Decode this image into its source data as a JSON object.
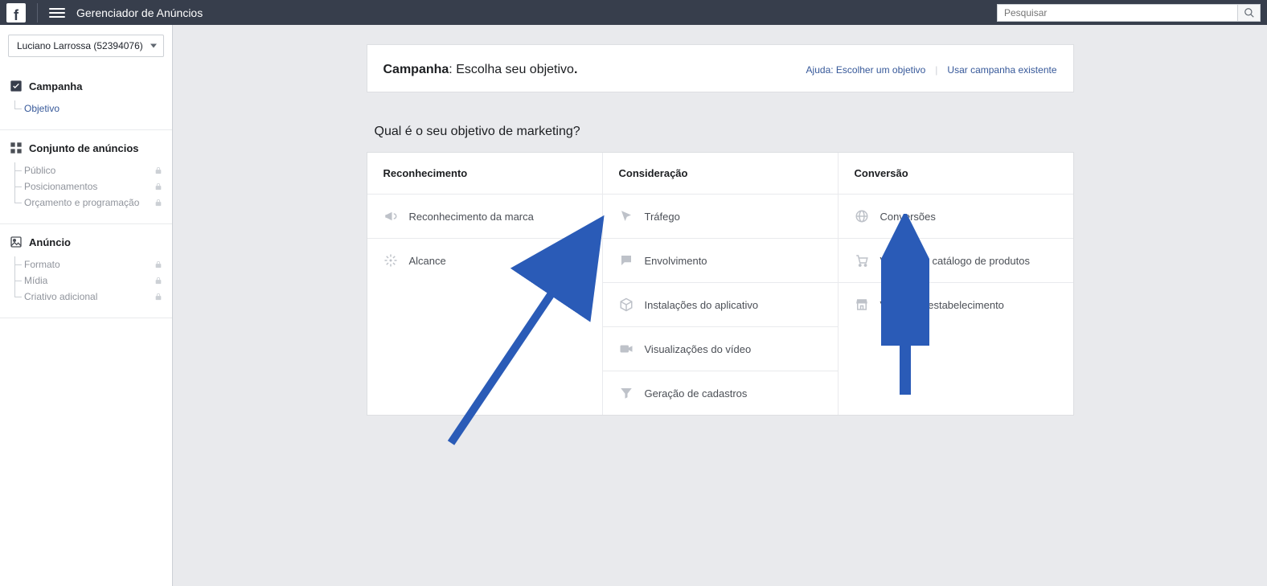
{
  "header": {
    "app_title": "Gerenciador de Anúncios",
    "search_placeholder": "Pesquisar"
  },
  "account_selector": {
    "label": "Luciano Larrossa (52394076)"
  },
  "sidebar": {
    "sections": [
      {
        "title": "Campanha",
        "items": [
          {
            "label": "Objetivo",
            "active": true,
            "locked": false
          }
        ]
      },
      {
        "title": "Conjunto de anúncios",
        "items": [
          {
            "label": "Público",
            "active": false,
            "locked": true
          },
          {
            "label": "Posicionamentos",
            "active": false,
            "locked": true
          },
          {
            "label": "Orçamento e programação",
            "active": false,
            "locked": true
          }
        ]
      },
      {
        "title": "Anúncio",
        "items": [
          {
            "label": "Formato",
            "active": false,
            "locked": true
          },
          {
            "label": "Mídia",
            "active": false,
            "locked": true
          },
          {
            "label": "Criativo adicional",
            "active": false,
            "locked": true
          }
        ]
      }
    ]
  },
  "main": {
    "card_title_strong": "Campanha",
    "card_title_rest": ": Escolha seu objetivo",
    "card_title_dot": ".",
    "help_link": "Ajuda: Escolher um objetivo",
    "use_existing": "Usar campanha existente",
    "question": "Qual é o seu objetivo de marketing?",
    "columns": [
      {
        "header": "Reconhecimento",
        "items": [
          {
            "icon": "megaphone",
            "label": "Reconhecimento da marca"
          },
          {
            "icon": "reach",
            "label": "Alcance"
          }
        ]
      },
      {
        "header": "Consideração",
        "items": [
          {
            "icon": "cursor",
            "label": "Tráfego"
          },
          {
            "icon": "comment",
            "label": "Envolvimento"
          },
          {
            "icon": "box",
            "label": "Instalações do aplicativo"
          },
          {
            "icon": "video",
            "label": "Visualizações do vídeo"
          },
          {
            "icon": "funnel",
            "label": "Geração de cadastros"
          }
        ]
      },
      {
        "header": "Conversão",
        "items": [
          {
            "icon": "globe",
            "label": "Conversões"
          },
          {
            "icon": "cart",
            "label": "Vendas do catálogo de produtos"
          },
          {
            "icon": "store",
            "label": "Visitas ao estabelecimento"
          }
        ]
      }
    ]
  }
}
